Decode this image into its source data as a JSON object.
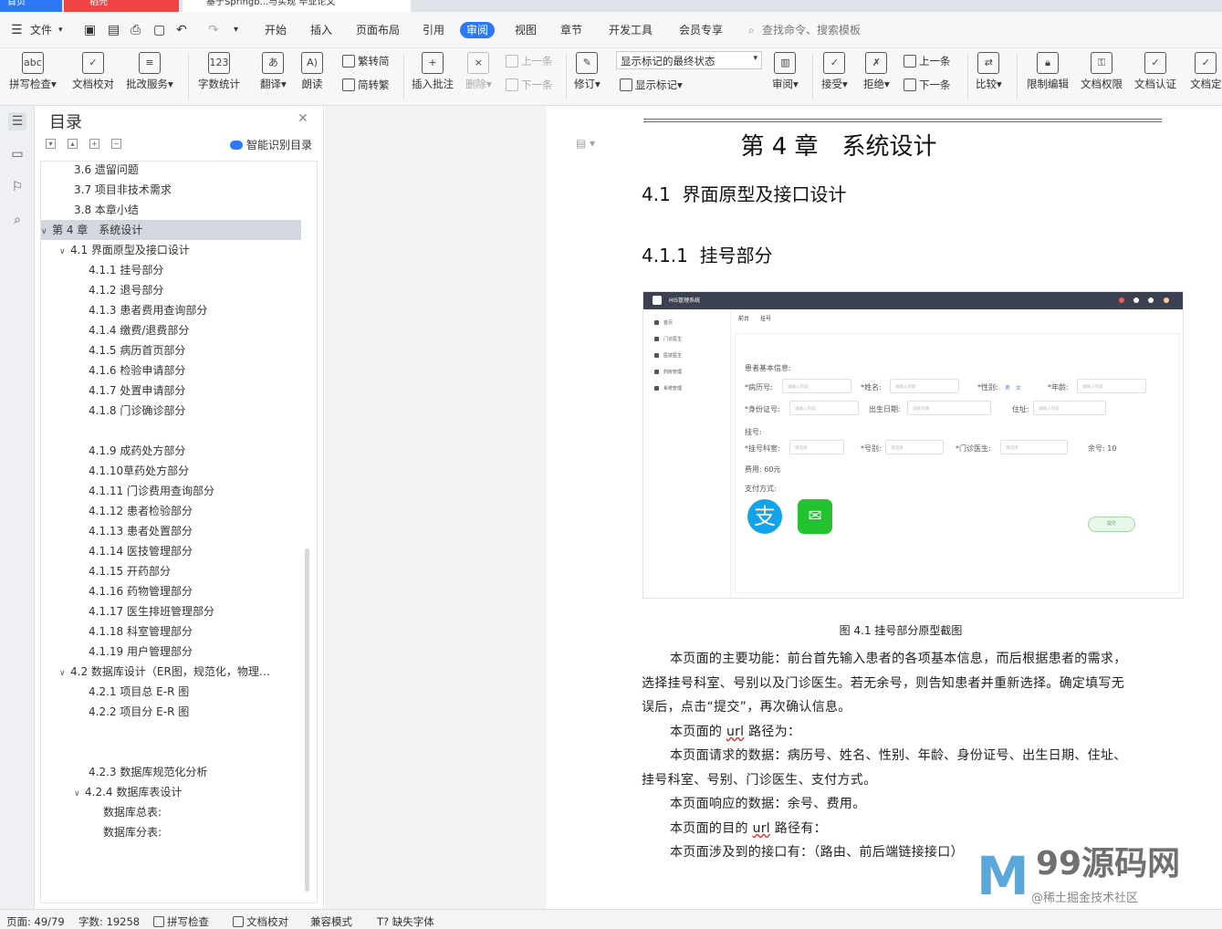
{
  "tabs": {
    "home": "首页",
    "draft": "稻壳",
    "doc": "基于Springb...与实现 毕业论文"
  },
  "menu": {
    "file": "文件",
    "items": [
      "开始",
      "插入",
      "页面布局",
      "引用",
      "审阅",
      "视图",
      "章节",
      "开发工具",
      "会员专享"
    ],
    "active": "审阅",
    "search": "查找命令、搜索模板"
  },
  "ribbon": {
    "spell": "拼写检查",
    "proof": "文档校对",
    "batch": "批改服务",
    "wordcount": "字数统计",
    "translate": "翻译",
    "read": "朗读",
    "to_trad": "繁转简",
    "to_simp": "简转繁",
    "insert_comment": "插入批注",
    "delete": "删除",
    "prev": "上一条",
    "next": "下一条",
    "track": "修订",
    "markup_state": "显示标记的最终状态",
    "show_markup": "显示标记",
    "review": "审阅",
    "accept": "接受",
    "reject": "拒绝",
    "prev2": "上一条",
    "next2": "下一条",
    "compare": "比较",
    "restrict": "限制编辑",
    "permission": "文档权限",
    "certify": "文档认证",
    "finalize": "文档定"
  },
  "toc": {
    "title": "目录",
    "ai_label": "智能识别目录",
    "items": [
      {
        "label": "3.6 遗留问题",
        "level": 2
      },
      {
        "label": "3.7 项目非技术需求",
        "level": 2
      },
      {
        "label": "3.8 本章小结",
        "level": 2
      },
      {
        "label": "第 4 章　系统设计",
        "level": 1
      },
      {
        "label": "4.1  界面原型及接口设计",
        "level": 2
      },
      {
        "label": "4.1.1  挂号部分",
        "level": 3
      },
      {
        "label": "4.1.2  退号部分",
        "level": 3
      },
      {
        "label": "4.1.3  患者费用查询部分",
        "level": 3
      },
      {
        "label": "4.1.4  缴费/退费部分",
        "level": 3
      },
      {
        "label": "4.1.5  病历首页部分",
        "level": 3
      },
      {
        "label": "4.1.6  检验申请部分",
        "level": 3
      },
      {
        "label": "4.1.7  处置申请部分",
        "level": 3
      },
      {
        "label": "4.1.8  门诊确诊部分",
        "level": 3
      },
      {
        "label": "",
        "level": 3
      },
      {
        "label": "4.1.9  成药处方部分",
        "level": 3
      },
      {
        "label": "4.1.10草药处方部分",
        "level": 3
      },
      {
        "label": "4.1.11 门诊费用查询部分",
        "level": 3
      },
      {
        "label": "4.1.12 患者检验部分",
        "level": 3
      },
      {
        "label": "4.1.13 患者处置部分",
        "level": 3
      },
      {
        "label": "4.1.14 医技管理部分",
        "level": 3
      },
      {
        "label": "4.1.15 开药部分",
        "level": 3
      },
      {
        "label": "4.1.16 药物管理部分",
        "level": 3
      },
      {
        "label": "4.1.17 医生排班管理部分",
        "level": 3
      },
      {
        "label": "4.1.18 科室管理部分",
        "level": 3
      },
      {
        "label": "4.1.19 用户管理部分",
        "level": 3
      },
      {
        "label": "4.2  数据库设计（ER图，规范化，物理…",
        "level": 2
      },
      {
        "label": "4.2.1 项目总 E-R 图",
        "level": 3
      },
      {
        "label": "4.2.2 项目分 E-R 图",
        "level": 3
      },
      {
        "label": "",
        "level": 3
      },
      {
        "label": "",
        "level": 3
      },
      {
        "label": "4.2.3 数据库规范化分析",
        "level": 3
      },
      {
        "label": "4.2.4 数据库表设计",
        "level": 3
      },
      {
        "label": "数据库总表:",
        "level": 4
      },
      {
        "label": "数据库分表:",
        "level": 4
      }
    ]
  },
  "doc": {
    "chapter": "第 4 章　系统设计",
    "section": "4.1  界面原型及接口设计",
    "subsection": "4.1.1  挂号部分",
    "caption": "图 4.1 挂号部分原型截图",
    "paragraphs": [
      "本页面的主要功能：前台首先输入患者的各项基本信息，而后根据患者的需求，",
      "选择挂号科室、号别以及门诊医生。若无余号，则告知患者并重新选择。确定填写无",
      "误后，点击“提交”，再次确认信息。",
      "本页面的 url 路径为：",
      "本页面请求的数据：病历号、姓名、性别、年龄、身份证号、出生日期、住址、",
      "挂号科室、号别、门诊医生、支付方式。",
      "本页面响应的数据：余号、费用。",
      "本页面的目的 url 路径有：",
      "本页面涉及到的接口有：（路由、前后端链接接口）"
    ]
  },
  "shot": {
    "app_title": "HIS管理系统",
    "side_items": [
      "首页",
      "门诊医生",
      "医技医生",
      "药房管理",
      "系统管理"
    ],
    "tabs": "前台　　挂号",
    "patient_info": "患者基本信息:",
    "record_no": "*病历号:",
    "name": "*姓名:",
    "gender": "*性别:",
    "gender_opts": "男　女",
    "age": "*年龄:",
    "id_no": "*身份证号:",
    "birth": "出生日期:",
    "address": "住址:",
    "register": "挂号:",
    "dept": "*挂号科室:",
    "level": "*号别:",
    "doctor": "*门诊医生:",
    "remaining": "余号:  10",
    "fee": "费用:  60元",
    "pay": "支付方式:",
    "placeholder": "请输入内容",
    "select_placeholder": "请选择",
    "date_placeholder": "选择日期",
    "submit": "提交",
    "alipay_glyph": "支",
    "wechat_glyph": "✉"
  },
  "watermark": {
    "title": "99源码网",
    "sub": "@稀土掘金技术社区",
    "mark": "M"
  },
  "status": {
    "page": "页面: 49/79",
    "words": "字数: 19258",
    "spell": "拼写检查",
    "proof": "文档校对",
    "compat": "兼容模式",
    "missing_font": "缺失字体"
  }
}
